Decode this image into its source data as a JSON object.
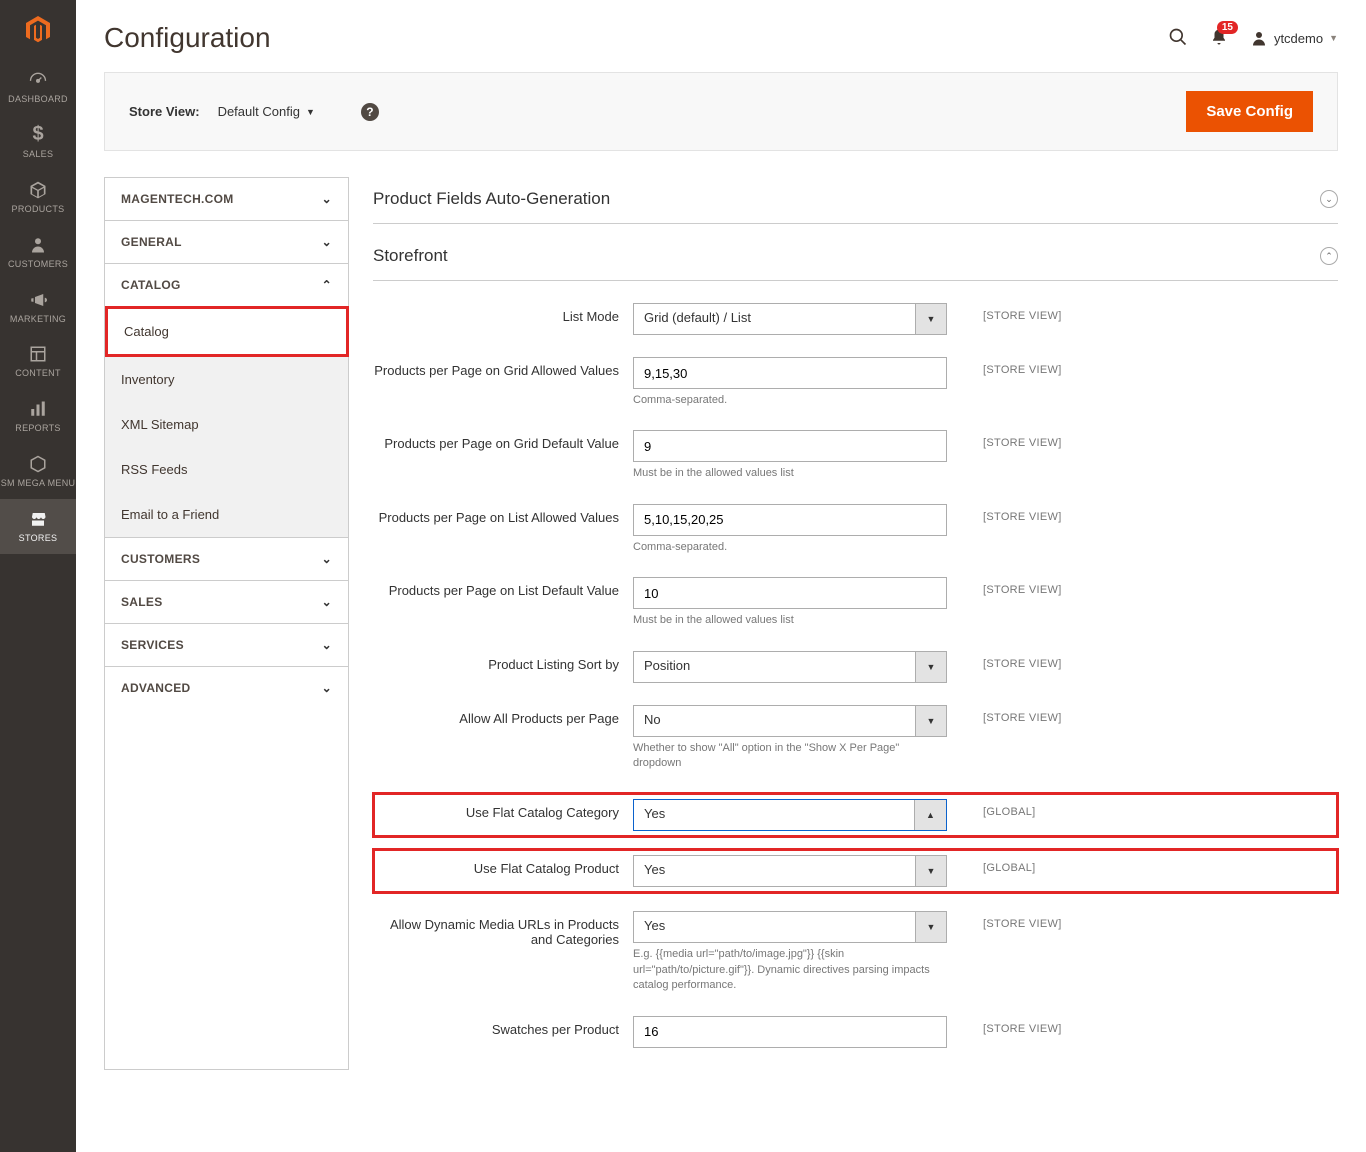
{
  "nav": {
    "items": [
      {
        "label": "DASHBOARD",
        "icon": "dashboard"
      },
      {
        "label": "SALES",
        "icon": "dollar"
      },
      {
        "label": "PRODUCTS",
        "icon": "cube"
      },
      {
        "label": "CUSTOMERS",
        "icon": "person"
      },
      {
        "label": "MARKETING",
        "icon": "megaphone"
      },
      {
        "label": "CONTENT",
        "icon": "layout"
      },
      {
        "label": "REPORTS",
        "icon": "bars"
      },
      {
        "label": "SM MEGA MENU",
        "icon": "hexagon"
      },
      {
        "label": "STORES",
        "icon": "storefront"
      }
    ]
  },
  "header": {
    "title": "Configuration",
    "notifications_count": "15",
    "username": "ytcdemo"
  },
  "storeview": {
    "label": "Store View:",
    "value": "Default Config",
    "save_label": "Save Config"
  },
  "tree": {
    "sections": [
      {
        "label": "MAGENTECH.COM",
        "expanded": false
      },
      {
        "label": "GENERAL",
        "expanded": false
      },
      {
        "label": "CATALOG",
        "expanded": true,
        "items": [
          {
            "label": "Catalog",
            "active": true
          },
          {
            "label": "Inventory"
          },
          {
            "label": "XML Sitemap"
          },
          {
            "label": "RSS Feeds"
          },
          {
            "label": "Email to a Friend"
          }
        ]
      },
      {
        "label": "CUSTOMERS",
        "expanded": false
      },
      {
        "label": "SALES",
        "expanded": false
      },
      {
        "label": "SERVICES",
        "expanded": false
      },
      {
        "label": "ADVANCED",
        "expanded": false
      }
    ]
  },
  "sections": {
    "auto_gen": "Product Fields Auto-Generation",
    "storefront": "Storefront"
  },
  "fields": {
    "list_mode": {
      "label": "List Mode",
      "value": "Grid (default) / List",
      "scope": "[STORE VIEW]"
    },
    "grid_allowed": {
      "label": "Products per Page on Grid Allowed Values",
      "value": "9,15,30",
      "note": "Comma-separated.",
      "scope": "[STORE VIEW]"
    },
    "grid_default": {
      "label": "Products per Page on Grid Default Value",
      "value": "9",
      "note": "Must be in the allowed values list",
      "scope": "[STORE VIEW]"
    },
    "list_allowed": {
      "label": "Products per Page on List Allowed Values",
      "value": "5,10,15,20,25",
      "note": "Comma-separated.",
      "scope": "[STORE VIEW]"
    },
    "list_default": {
      "label": "Products per Page on List Default Value",
      "value": "10",
      "note": "Must be in the allowed values list",
      "scope": "[STORE VIEW]"
    },
    "sort_by": {
      "label": "Product Listing Sort by",
      "value": "Position",
      "scope": "[STORE VIEW]"
    },
    "allow_all": {
      "label": "Allow All Products per Page",
      "value": "No",
      "note": "Whether to show \"All\" option in the \"Show X Per Page\" dropdown",
      "scope": "[STORE VIEW]"
    },
    "flat_category": {
      "label": "Use Flat Catalog Category",
      "value": "Yes",
      "scope": "[GLOBAL]"
    },
    "flat_product": {
      "label": "Use Flat Catalog Product",
      "value": "Yes",
      "scope": "[GLOBAL]"
    },
    "dynamic_media": {
      "label": "Allow Dynamic Media URLs in Products and Categories",
      "value": "Yes",
      "note": "E.g. {{media url=\"path/to/image.jpg\"}} {{skin url=\"path/to/picture.gif\"}}. Dynamic directives parsing impacts catalog performance.",
      "scope": "[STORE VIEW]"
    },
    "swatches": {
      "label": "Swatches per Product",
      "value": "16",
      "scope": "[STORE VIEW]"
    }
  }
}
